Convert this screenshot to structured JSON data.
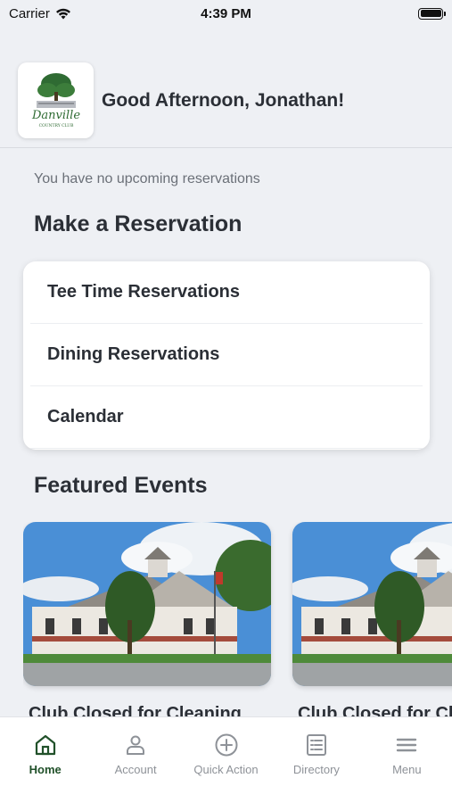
{
  "status_bar": {
    "carrier": "Carrier",
    "time": "4:39 PM"
  },
  "header": {
    "logo_text": "Danville",
    "logo_subtext": "COUNTRY CLUB",
    "greeting": "Good Afternoon, Jonathan!"
  },
  "reservations": {
    "empty_message": "You have no upcoming reservations",
    "section_title": "Make a Reservation",
    "items": [
      {
        "label": "Tee Time Reservations"
      },
      {
        "label": "Dining Reservations"
      },
      {
        "label": "Calendar"
      }
    ]
  },
  "events": {
    "section_title": "Featured Events",
    "items": [
      {
        "title": "Club Closed for Cleaning"
      },
      {
        "title": "Club Closed for Cleaning"
      }
    ]
  },
  "tab_bar": {
    "accent_color": "#21512a",
    "tabs": [
      {
        "label": "Home",
        "icon": "home-icon",
        "active": true
      },
      {
        "label": "Account",
        "icon": "account-icon"
      },
      {
        "label": "Quick Action",
        "icon": "plus-circle-icon"
      },
      {
        "label": "Directory",
        "icon": "directory-icon"
      },
      {
        "label": "Menu",
        "icon": "menu-icon"
      }
    ]
  }
}
